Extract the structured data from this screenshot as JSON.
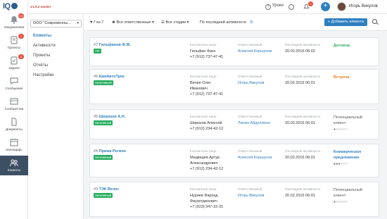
{
  "app": {
    "logo": "IQ",
    "version": "v.1.5.2 master"
  },
  "sidebar": {
    "items": [
      {
        "label": "Уведомления",
        "badge": "14",
        "icon": "bell-icon"
      },
      {
        "label": "Проекты",
        "badge": "1",
        "icon": "folder-icon"
      },
      {
        "label": "Задачи",
        "badge": "5",
        "icon": "tasks-icon"
      },
      {
        "label": "Сообщения",
        "badge": "",
        "icon": "message-icon"
      },
      {
        "label": "Сообщества",
        "badge": "",
        "icon": "community-icon"
      },
      {
        "label": "Документы",
        "badge": "",
        "icon": "document-icon"
      },
      {
        "label": "Календарь",
        "badge": "",
        "icon": "calendar-icon"
      },
      {
        "label": "Клиенты",
        "badge": "",
        "icon": "clients-icon"
      }
    ]
  },
  "topbar": {
    "lessons": "Уроки",
    "bell_badge": "2",
    "plus": "+",
    "user_name": "Игорь Викулов"
  },
  "secnav": {
    "company": "ООО \"Современны...",
    "items": [
      "Клиенты",
      "Активности",
      "Проекты",
      "Отчёты",
      "Настройки"
    ]
  },
  "filters": {
    "pagination": "7 из 7",
    "responsible": "Все ответственные",
    "stages": "Все стадии",
    "sort": "По последней активности",
    "add_client": "+ Добавить клиента"
  },
  "labels": {
    "contact": "Контактное лицо",
    "responsible": "Ответственный",
    "last_activity": "Последняя активность"
  },
  "clients": [
    {
      "num": "#7",
      "name": "Гильфанов Ф.М.",
      "tag": "VIP",
      "tag_color": "#27ae60",
      "contact": [
        "Гильфан Факх"
      ],
      "phone": "+7 (912) 737-47-41",
      "responsible": "Алексей Коршунов",
      "activity": "20.02.2016 06:02",
      "stage": [
        "Договор"
      ],
      "stage_color": "#27ae60",
      "dots": ""
    },
    {
      "num": "#6",
      "name": "КамАвтоТрек",
      "tag": "Неактивный",
      "tag_color": "#27ae60",
      "contact": [
        "Вичин Олег",
        "Иванович"
      ],
      "phone": "+7 (912) 737-47-41",
      "responsible": "Игорь Викулов",
      "activity": "20.02.2016 06:01",
      "stage": [
        "Встреча"
      ],
      "stage_color": "#e67e22",
      "dots": ""
    },
    {
      "num": "#5",
      "name": "Широков А.Н.",
      "tag": "Негативный",
      "tag_color": "#27ae60",
      "contact": [
        "Широков Алексей"
      ],
      "phone": "+7 (912) 234-42-12",
      "responsible": "Лилия Абдуллина",
      "activity": "20.02.2016 06:01",
      "stage": [
        "Потенциальный",
        "клиент"
      ],
      "stage_color": "",
      "dots": "●○○○○○"
    },
    {
      "num": "#4",
      "name": "Прима Регион",
      "tag": "Негативный",
      "tag_color": "#27ae60",
      "contact": [
        "Медведев Артур",
        "Александрович"
      ],
      "phone": "+7 (912) 234-42-12",
      "responsible": "Алексей Коршунов",
      "activity": "20.02.2016 06:01",
      "stage": [
        "Коммерческое",
        "предложение"
      ],
      "stage_color": "#2e7fc0",
      "dots": "●●●○○○"
    },
    {
      "num": "#3",
      "name": "ТЭК Велес",
      "tag": "Негативный",
      "tag_color": "#27ae60",
      "contact": [
        "Нуриев Фархад",
        "Фаузетдинович"
      ],
      "phone": "+7 (923) 347-32-31",
      "responsible": "Игорь Викулов",
      "activity": "20.02.2016 06:01",
      "stage": [
        "Потенциальный",
        "клиент"
      ],
      "stage_color": "",
      "dots": "●○○○○○"
    }
  ]
}
